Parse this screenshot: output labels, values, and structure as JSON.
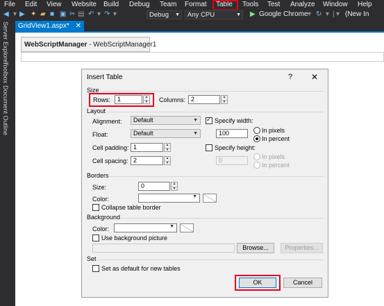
{
  "menu": [
    "File",
    "Edit",
    "View",
    "Website",
    "Build",
    "Debug",
    "Team",
    "Format",
    "Table",
    "Tools",
    "Test",
    "Analyze",
    "Window",
    "Help"
  ],
  "toolbar": {
    "config": "Debug",
    "platform": "Any CPU",
    "browser": "Google Chrome",
    "new_instance": "(New In"
  },
  "side_tabs": [
    "Server Explorer",
    "Toolbox",
    "Document Outline"
  ],
  "doc_tab": {
    "title": "GridView1.aspx*",
    "close": "✕"
  },
  "designer": {
    "control_type": "WebScriptManager",
    "control_id": "- WebScriptManager1"
  },
  "dialog": {
    "title": "Insert Table",
    "help": "?",
    "close": "✕",
    "size": {
      "label": "Size",
      "rows_label": "Rows:",
      "rows_value": "1",
      "columns_label": "Columns:",
      "columns_value": "2"
    },
    "layout": {
      "label": "Layout",
      "alignment_label": "Alignment:",
      "alignment_value": "Default",
      "float_label": "Float:",
      "float_value": "Default",
      "cell_padding_label": "Cell padding:",
      "cell_padding_value": "1",
      "cell_spacing_label": "Cell spacing:",
      "cell_spacing_value": "2",
      "specify_width_label": "Specify width:",
      "specify_width_checked": true,
      "width_value": "100",
      "in_pixels": "In pixels",
      "in_percent": "In percent",
      "specify_height_label": "Specify height:",
      "specify_height_checked": false,
      "height_value": "0"
    },
    "borders": {
      "label": "Borders",
      "size_label": "Size:",
      "size_value": "0",
      "color_label": "Color:",
      "collapse_label": "Collapse table border"
    },
    "background": {
      "label": "Background",
      "color_label": "Color:",
      "use_picture_label": "Use background picture",
      "browse": "Browse...",
      "properties": "Properties..."
    },
    "set": {
      "label": "Set",
      "default_label": "Set as default for new tables"
    },
    "ok": "OK",
    "cancel": "Cancel"
  },
  "colors": {
    "vs_dark": "#2d2d30",
    "accent": "#007acc",
    "highlight": "#e4001b"
  }
}
